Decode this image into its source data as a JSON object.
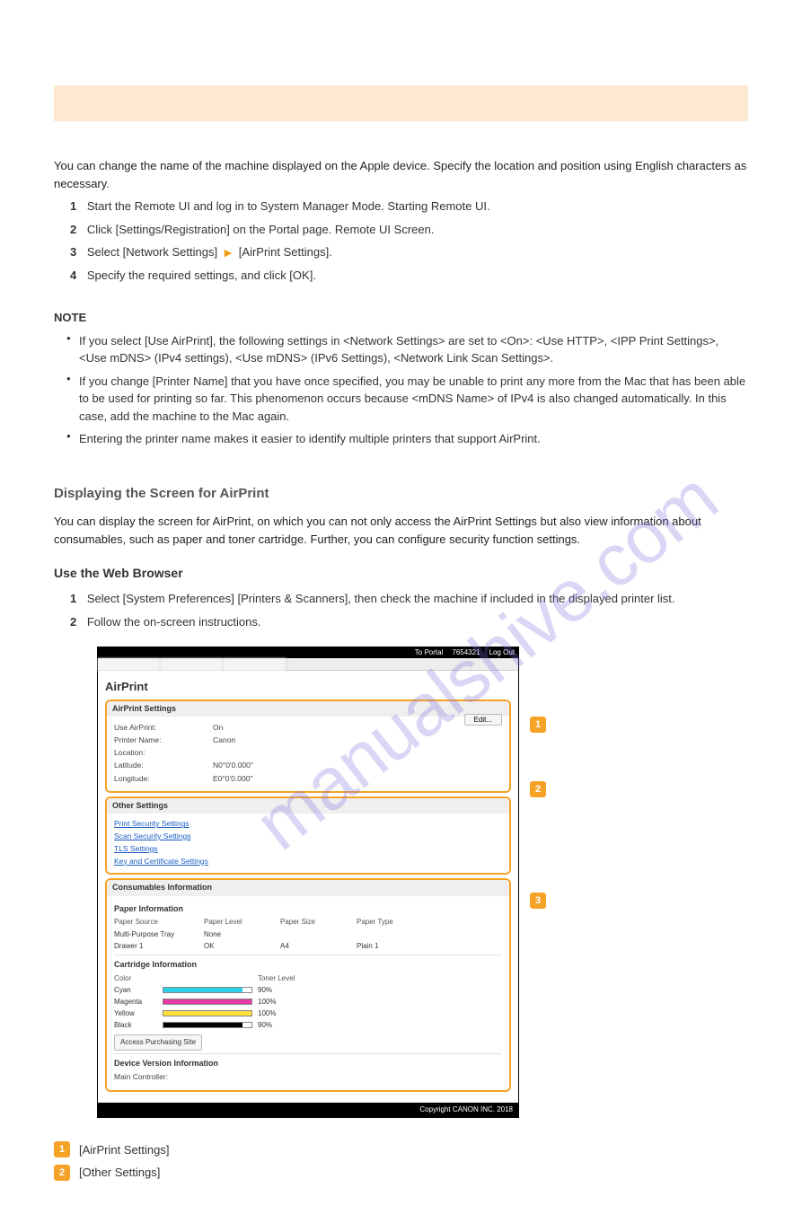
{
  "banner": {
    "title": ""
  },
  "intro": "You can change the name of the machine displayed on the Apple device. Specify the location and position using English characters as necessary.",
  "steps": {
    "s1_num": "1",
    "s1_text": "Start the Remote UI and log in to System Manager Mode. Starting Remote UI.",
    "s2_num": "2",
    "s2_text_a": "Click [Settings/Registration] on the Portal page. ",
    "s2_text_b": "Remote UI Screen.",
    "s3_num": "3",
    "s3_text_a": "Select [Network Settings] ",
    "s3_text_b": " [AirPrint Settings].",
    "s4_num": "4",
    "s4_text": "Specify the required settings, and click [OK]."
  },
  "notes": {
    "label": "NOTE",
    "items": [
      "If you select [Use AirPrint], the following settings in <Network Settings> are set to <On>: <Use HTTP>, <IPP Print Settings>, <Use mDNS> (IPv4 settings), <Use mDNS> (IPv6 Settings), <Network Link Scan Settings>.",
      "If you change [Printer Name] that you have once specified, you may be unable to print any more from the Mac that has been able to be used for printing so far. This phenomenon occurs because <mDNS Name> of IPv4 is also changed automatically. In this case, add the machine to the Mac again.",
      "Entering the printer name makes it easier to identify multiple printers that support AirPrint."
    ]
  },
  "section_title": "Displaying the Screen for AirPrint",
  "section_text": "You can display the screen for AirPrint, on which you can not only access the AirPrint Settings but also view information about consumables, such as paper and toner cartridge. Further, you can configure security function settings.",
  "method_title": "Use the Web Browser",
  "method_steps": {
    "m1_num": "1",
    "m1_text": "Select [System Preferences] [Printers & Scanners], then check the machine if included in the displayed printer list.",
    "m2_num": "2",
    "m2_text": "Follow the on-screen instructions."
  },
  "shot": {
    "top_links": {
      "portal": "To Portal",
      "user": "7654321",
      "logout": "Log Out"
    },
    "title": "AirPrint",
    "panel1": {
      "head": "AirPrint Settings",
      "edit": "Edit...",
      "rows": [
        {
          "k": "Use AirPrint:",
          "v": "On"
        },
        {
          "k": "Printer Name:",
          "v": "Canon"
        },
        {
          "k": "Location:",
          "v": ""
        },
        {
          "k": "Latitude:",
          "v": "N0°0'0.000\""
        },
        {
          "k": "Longitude:",
          "v": "E0°0'0.000\""
        }
      ]
    },
    "panel2": {
      "head": "Other Settings",
      "links": [
        "Print Security Settings",
        "Scan Security Settings",
        "TLS Settings",
        "Key and Certificate Settings"
      ]
    },
    "panel3": {
      "head": "Consumables Information",
      "paper_title": "Paper Information",
      "paper_head": {
        "c1": "Paper Source",
        "c2": "Paper Level",
        "c3": "Paper Size",
        "c4": "Paper Type"
      },
      "paper_rows": [
        {
          "c1": "Multi-Purpose Tray",
          "c2": "None",
          "c3": "",
          "c4": ""
        },
        {
          "c1": "Drawer 1",
          "c2": "OK",
          "c3": "A4",
          "c4": "Plain 1"
        }
      ],
      "cart_title": "Cartridge Information",
      "toner_head_left": "Color",
      "toner_head_right": "Toner Level",
      "toners": [
        {
          "name": "Cyan",
          "color": "#2ad0e8",
          "pct": 90,
          "label": "90%"
        },
        {
          "name": "Magenta",
          "color": "#e63aa5",
          "pct": 100,
          "label": "100%"
        },
        {
          "name": "Yellow",
          "color": "#ffe13a",
          "pct": 100,
          "label": "100%"
        },
        {
          "name": "Black",
          "color": "#000000",
          "pct": 90,
          "label": "90%"
        }
      ],
      "purchase_btn": "Access Purchasing Site",
      "dev_title": "Device Version Information",
      "dev_row": {
        "k": "Main Controller:",
        "v": ""
      }
    },
    "footer": "Copyright CANON INC. 2018"
  },
  "legend": {
    "items": [
      {
        "num": "1",
        "label": "[AirPrint Settings]"
      },
      {
        "num": "2",
        "label": "[Other Settings]"
      }
    ]
  },
  "watermark": "manualshive.com"
}
